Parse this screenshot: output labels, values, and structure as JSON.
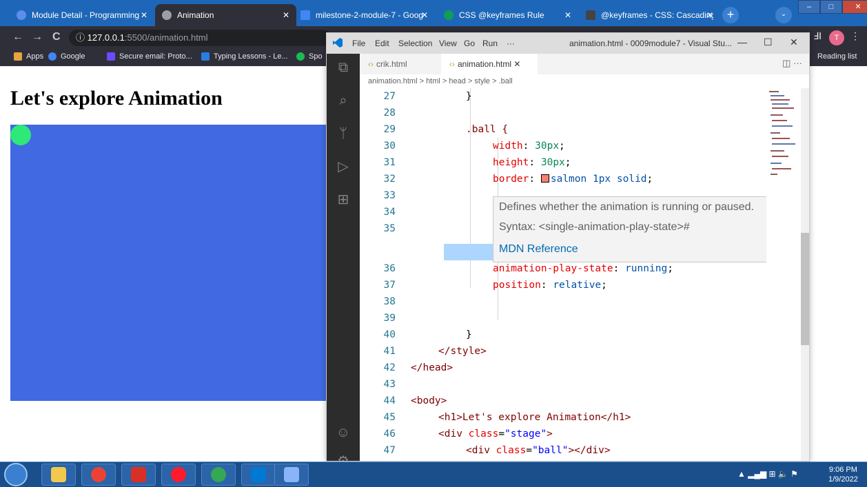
{
  "browser": {
    "tabs": [
      {
        "title": "Module Detail - Programming",
        "color": "#5b8def"
      },
      {
        "title": "Animation",
        "color": "#9aa0a6"
      },
      {
        "title": "milestone-2-module-7 - Goog",
        "color": "#4285f4"
      },
      {
        "title": "CSS @keyframes Rule",
        "color": "#0f9d58"
      },
      {
        "title": "@keyframes - CSS: Cascading",
        "color": "#444444"
      }
    ],
    "nav": {
      "back": "←",
      "forward": "→",
      "reload": "C"
    },
    "address": {
      "host": "127.0.0.1",
      "path": ":5500/animation.html"
    },
    "profile_initial": "T",
    "bookmarks": [
      {
        "label": "Apps",
        "color": "#e8a33d"
      },
      {
        "label": "Google",
        "color": "#4285f4"
      },
      {
        "label": "Secure email: Proto...",
        "color": "#6d4aff"
      },
      {
        "label": "Typing Lessons - Le...",
        "color": "#2a7de1"
      },
      {
        "label": "Spo",
        "color": "#1db954"
      }
    ],
    "reading_list": "Reading list"
  },
  "page": {
    "heading": "Let's explore Animation",
    "stage_color": "#4169e1",
    "ball_color": "#2ee878"
  },
  "vscode": {
    "menu": [
      "File",
      "Edit",
      "Selection",
      "View",
      "Go",
      "Run",
      "···"
    ],
    "window_title": "animation.html - 0009module7 - Visual Stu...",
    "editor_tabs": [
      "crik.html",
      "animation.html"
    ],
    "breadcrumb": "animation.html > html > head > style > .ball",
    "lines": [
      {
        "n": "27",
        "text": "}"
      },
      {
        "n": "28",
        "text": ""
      },
      {
        "n": "29",
        "text": ".ball {"
      },
      {
        "n": "30",
        "prop": "width",
        "val": "30px"
      },
      {
        "n": "31",
        "prop": "height",
        "val": "30px"
      },
      {
        "n": "32",
        "prop": "border",
        "val": "salmon 1px solid"
      },
      {
        "n": "33",
        "text": ""
      },
      {
        "n": "34",
        "text": ""
      },
      {
        "n": "35",
        "text": ""
      },
      {
        "n": "36",
        "prop": "animation-play-state",
        "val": "running"
      },
      {
        "n": "37",
        "prop": "position",
        "val": "relative"
      },
      {
        "n": "38",
        "text": ""
      },
      {
        "n": "39",
        "text": ""
      },
      {
        "n": "40",
        "text": "}"
      },
      {
        "n": "41",
        "text": "</style>"
      },
      {
        "n": "42",
        "text": "</head>"
      },
      {
        "n": "43",
        "text": ""
      },
      {
        "n": "44",
        "text": "<body>"
      },
      {
        "n": "45",
        "text": "<h1>Let's explore Animation</h1>"
      },
      {
        "n": "46",
        "tag": "div",
        "attr": "class",
        "str": "\"stage\""
      },
      {
        "n": "47",
        "tag": "div",
        "attr": "class",
        "str": "\"ball\""
      }
    ],
    "hover": {
      "description": "Defines whether the animation is running or paused.",
      "syntax": "Syntax: <single-animation-play-state>#",
      "link": "MDN Reference"
    }
  },
  "taskbar": {
    "apps": [
      {
        "name": "file-explorer",
        "color": "#f2c94c"
      },
      {
        "name": "chrome",
        "color": "#ea4335"
      },
      {
        "name": "acrobat",
        "color": "#d93025"
      },
      {
        "name": "opera",
        "color": "#ff1b2d"
      },
      {
        "name": "chrome-profile",
        "color": "#34a853"
      },
      {
        "name": "vscode",
        "color": "#0078d4"
      },
      {
        "name": "tablet",
        "color": "#8ab4f8"
      }
    ],
    "time": "9:06 PM",
    "date": "1/9/2022"
  }
}
